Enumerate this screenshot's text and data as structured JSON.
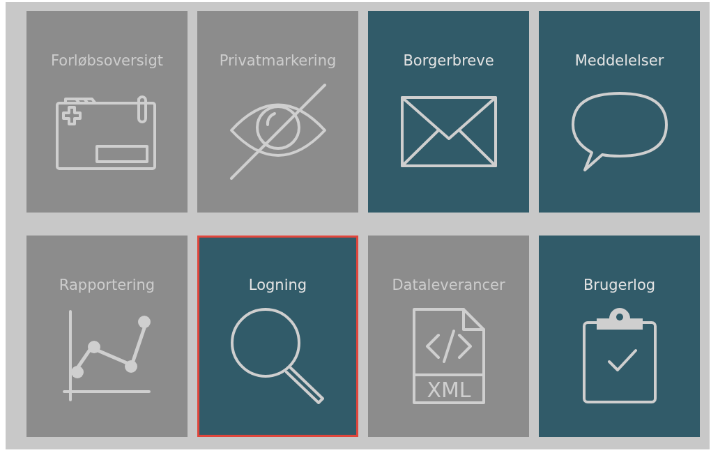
{
  "tiles": [
    {
      "title": "Forløbsoversigt",
      "kind": "folder",
      "active": false,
      "selected": false
    },
    {
      "title": "Privatmarkering",
      "kind": "eye",
      "active": false,
      "selected": false
    },
    {
      "title": "Borgerbreve",
      "kind": "envelope",
      "active": true,
      "selected": false
    },
    {
      "title": "Meddelelser",
      "kind": "speech",
      "active": true,
      "selected": false
    },
    {
      "title": "Rapportering",
      "kind": "chart",
      "active": false,
      "selected": false
    },
    {
      "title": "Logning",
      "kind": "search",
      "active": true,
      "selected": true
    },
    {
      "title": "Dataleverancer",
      "kind": "xml",
      "active": false,
      "selected": false,
      "icon_label": "XML"
    },
    {
      "title": "Brugerlog",
      "kind": "clipboard",
      "active": true,
      "selected": false
    }
  ]
}
